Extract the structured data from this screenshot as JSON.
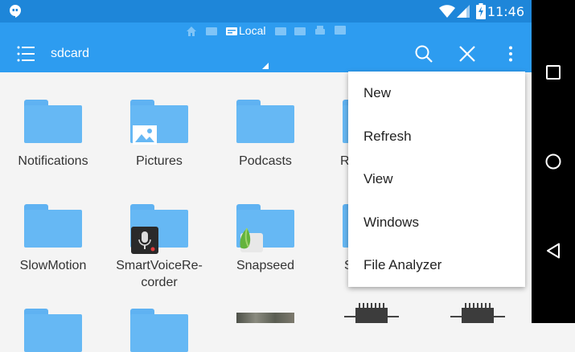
{
  "status": {
    "time": "11:46"
  },
  "header": {
    "location_tab": "Local",
    "path": "sdcard"
  },
  "items": [
    {
      "label": "Notifications"
    },
    {
      "label": "Pictures"
    },
    {
      "label": "Podcasts"
    },
    {
      "label": "R"
    },
    {
      "label": "SlowMotion"
    },
    {
      "label": "SmartVoiceRe-",
      "label2": "corder"
    },
    {
      "label": "Snapseed"
    },
    {
      "label": "S"
    }
  ],
  "menu": {
    "items": [
      {
        "label": "New"
      },
      {
        "label": "Refresh"
      },
      {
        "label": "View"
      },
      {
        "label": "Windows"
      },
      {
        "label": "File Analyzer"
      }
    ]
  },
  "icons": {
    "status_left": "hangouts-icon",
    "wifi": "wifi-icon",
    "signal": "signal-icon",
    "battery": "battery-icon",
    "menu": "list-menu-icon",
    "search": "search-icon",
    "close": "close-icon",
    "overflow": "overflow-menu-icon"
  }
}
